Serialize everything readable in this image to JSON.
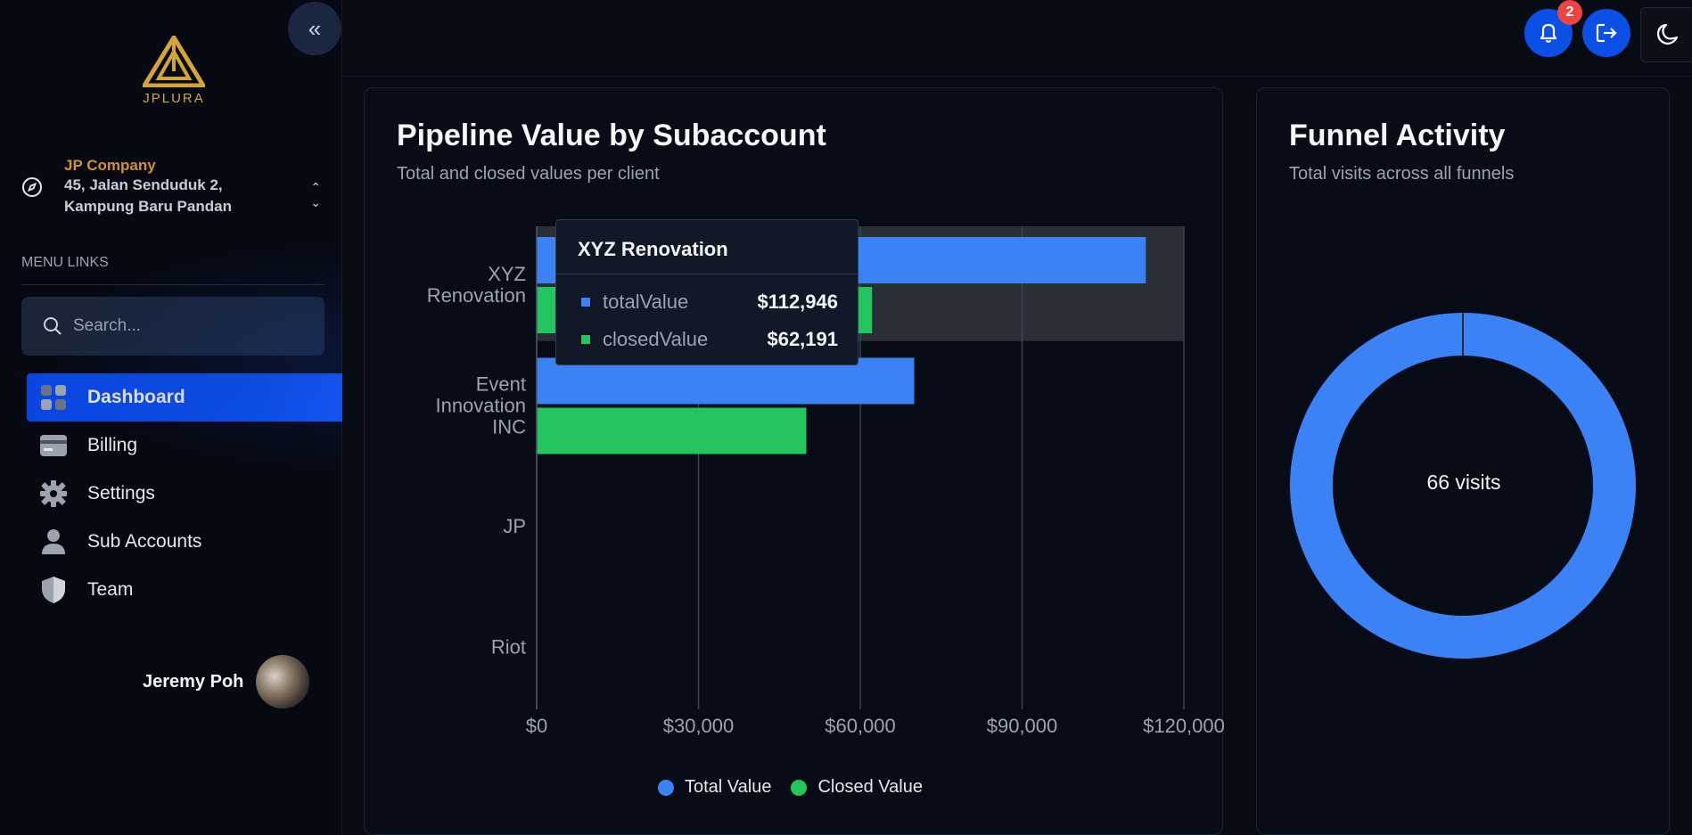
{
  "sidebar": {
    "logo_text": "JPLURA",
    "company": {
      "name": "JP Company",
      "address_line1": "45, Jalan Senduduk 2,",
      "address_line2": "Kampung Baru Pandan"
    },
    "menu_label": "MENU LINKS",
    "search_placeholder": "Search...",
    "items": [
      {
        "label": "Dashboard",
        "icon": "dashboard-icon",
        "active": true
      },
      {
        "label": "Billing",
        "icon": "card-icon"
      },
      {
        "label": "Settings",
        "icon": "gear-icon"
      },
      {
        "label": "Sub Accounts",
        "icon": "user-icon"
      },
      {
        "label": "Team",
        "icon": "shield-icon"
      }
    ],
    "user_name": "Jeremy Poh"
  },
  "topbar": {
    "notification_count": "2"
  },
  "pipeline_card": {
    "title": "Pipeline Value by Subaccount",
    "subtitle": "Total and closed values per client",
    "legend": {
      "total": "Total Value",
      "closed": "Closed Value"
    },
    "tooltip": {
      "title": "XYZ Renovation",
      "rows": [
        {
          "label": "totalValue",
          "value": "$112,946"
        },
        {
          "label": "closedValue",
          "value": "$62,191"
        }
      ]
    }
  },
  "funnel_card": {
    "title": "Funnel Activity",
    "subtitle": "Total visits across all funnels",
    "center_label": "66 visits"
  },
  "colors": {
    "total": "#3b82f6",
    "closed": "#22c55e",
    "accent": "#0a4fe6",
    "brand": "#d4a437"
  },
  "chart_data": [
    {
      "type": "bar",
      "orientation": "horizontal",
      "categories": [
        "XYZ Renovation",
        "Event Innovation INC",
        "JP",
        "Riot"
      ],
      "series": [
        {
          "name": "Total Value",
          "values": [
            112946,
            70000,
            0,
            0
          ]
        },
        {
          "name": "Closed Value",
          "values": [
            62191,
            50000,
            0,
            0
          ]
        }
      ],
      "xticks": [
        "$0",
        "$30,000",
        "$60,000",
        "$90,000",
        "$120,000"
      ],
      "xlim": [
        0,
        120000
      ],
      "grid": true,
      "legend": "bottom"
    },
    {
      "type": "pie",
      "donut": true,
      "values": [
        66
      ],
      "center_label": "66 visits"
    }
  ]
}
